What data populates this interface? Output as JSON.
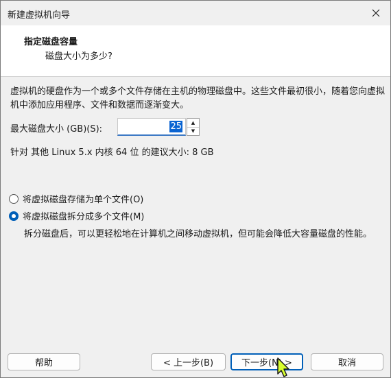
{
  "window": {
    "title": "新建虚拟机向导"
  },
  "header": {
    "title": "指定磁盘容量",
    "subtitle": "磁盘大小为多少?"
  },
  "description": "虚拟机的硬盘作为一个或多个文件存储在主机的物理磁盘中。这些文件最初很小，随着您向虚拟机中添加应用程序、文件和数据而逐渐变大。",
  "disk_size": {
    "label": "最大磁盘大小 (GB)(S):",
    "value": "25"
  },
  "recommendation": "针对 其他 Linux 5.x 内核 64 位 的建议大小: 8 GB",
  "options": {
    "single_file": {
      "label": "将虚拟磁盘存储为单个文件(O)",
      "checked": false
    },
    "multiple_files": {
      "label": "将虚拟磁盘拆分成多个文件(M)",
      "checked": true
    },
    "note": "拆分磁盘后，可以更轻松地在计算机之间移动虚拟机，但可能会降低大容量磁盘的性能。"
  },
  "buttons": {
    "help": "帮助",
    "back": "< 上一步(B)",
    "next": "下一步(N) >",
    "cancel": "取消"
  },
  "icons": {
    "close": "close-icon",
    "spin_up": "arrow-up-icon",
    "spin_down": "arrow-down-icon",
    "cursor": "mouse-cursor-icon"
  }
}
